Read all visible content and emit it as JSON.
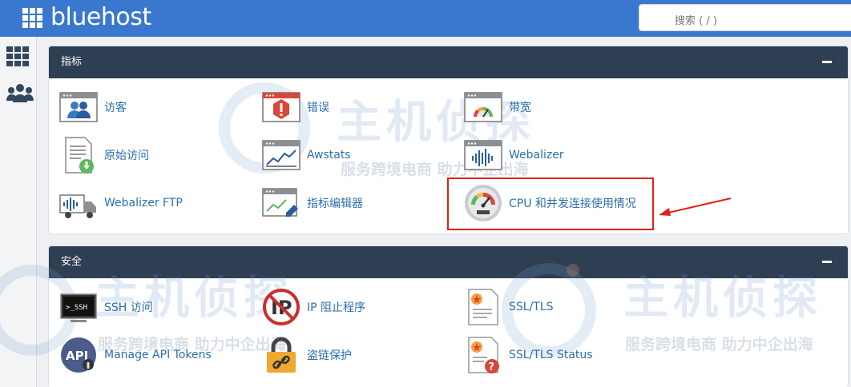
{
  "header": {
    "logo_text": "bluehost",
    "search_placeholder": "搜索 ( / )"
  },
  "sections": [
    {
      "title": "指标",
      "items": [
        {
          "label": "访客",
          "icon": "visitors-icon"
        },
        {
          "label": "错误",
          "icon": "errors-icon"
        },
        {
          "label": "带宽",
          "icon": "bandwidth-icon"
        },
        {
          "label": "原始访问",
          "icon": "raw-access-icon"
        },
        {
          "label": "Awstats",
          "icon": "awstats-icon"
        },
        {
          "label": "Webalizer",
          "icon": "webalizer-icon"
        },
        {
          "label": "Webalizer FTP",
          "icon": "webalizer-ftp-icon"
        },
        {
          "label": "指标编辑器",
          "icon": "metrics-editor-icon"
        },
        {
          "label": "CPU 和并发连接使用情况",
          "icon": "cpu-usage-icon"
        }
      ]
    },
    {
      "title": "安全",
      "items": [
        {
          "label": "SSH 访问",
          "icon": "ssh-icon"
        },
        {
          "label": "IP 阻止程序",
          "icon": "ip-blocker-icon"
        },
        {
          "label": "SSL/TLS",
          "icon": "ssl-tls-icon"
        },
        {
          "label": "Manage API Tokens",
          "icon": "api-tokens-icon"
        },
        {
          "label": "盗链保护",
          "icon": "hotlink-protection-icon"
        },
        {
          "label": "SSL/TLS Status",
          "icon": "ssl-tls-status-icon"
        }
      ]
    }
  ],
  "watermark": {
    "brand": "主机侦探",
    "slogan": "服务跨境电商 助力中企出海"
  },
  "colors": {
    "topbar": "#3a78d0",
    "panel_header": "#2f3f53",
    "link": "#2c6faa",
    "highlight": "#e0201b"
  }
}
